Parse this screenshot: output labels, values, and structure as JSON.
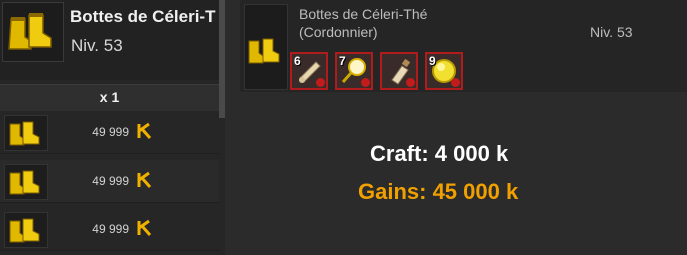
{
  "item": {
    "name": "Bottes de Céleri-T",
    "level": "Niv. 53",
    "icon": "yellow-boots-icon"
  },
  "listing": {
    "quantity_label": "x 1",
    "rows": [
      {
        "price": "49 999",
        "currency_icon": "kama-icon"
      },
      {
        "price": "49 999",
        "currency_icon": "kama-icon"
      },
      {
        "price": "49 999",
        "currency_icon": "kama-icon"
      }
    ]
  },
  "recipe": {
    "name": "Bottes de Céleri-Thé",
    "profession": "(Cordonnier)",
    "level": "Niv. 53",
    "ingredients": [
      {
        "qty": "6",
        "icon": "parchment-roll-icon"
      },
      {
        "qty": "7",
        "icon": "magnifier-icon"
      },
      {
        "qty": "",
        "icon": "bottle-icon"
      },
      {
        "qty": "9",
        "icon": "gold-orb-icon"
      }
    ]
  },
  "summary": {
    "craft": "Craft: 4 000 k",
    "gains": "Gains: 45 000 k"
  },
  "colors": {
    "gains": "#f0a000",
    "missing_border": "#b01c1c",
    "kama": "#f0b000"
  }
}
